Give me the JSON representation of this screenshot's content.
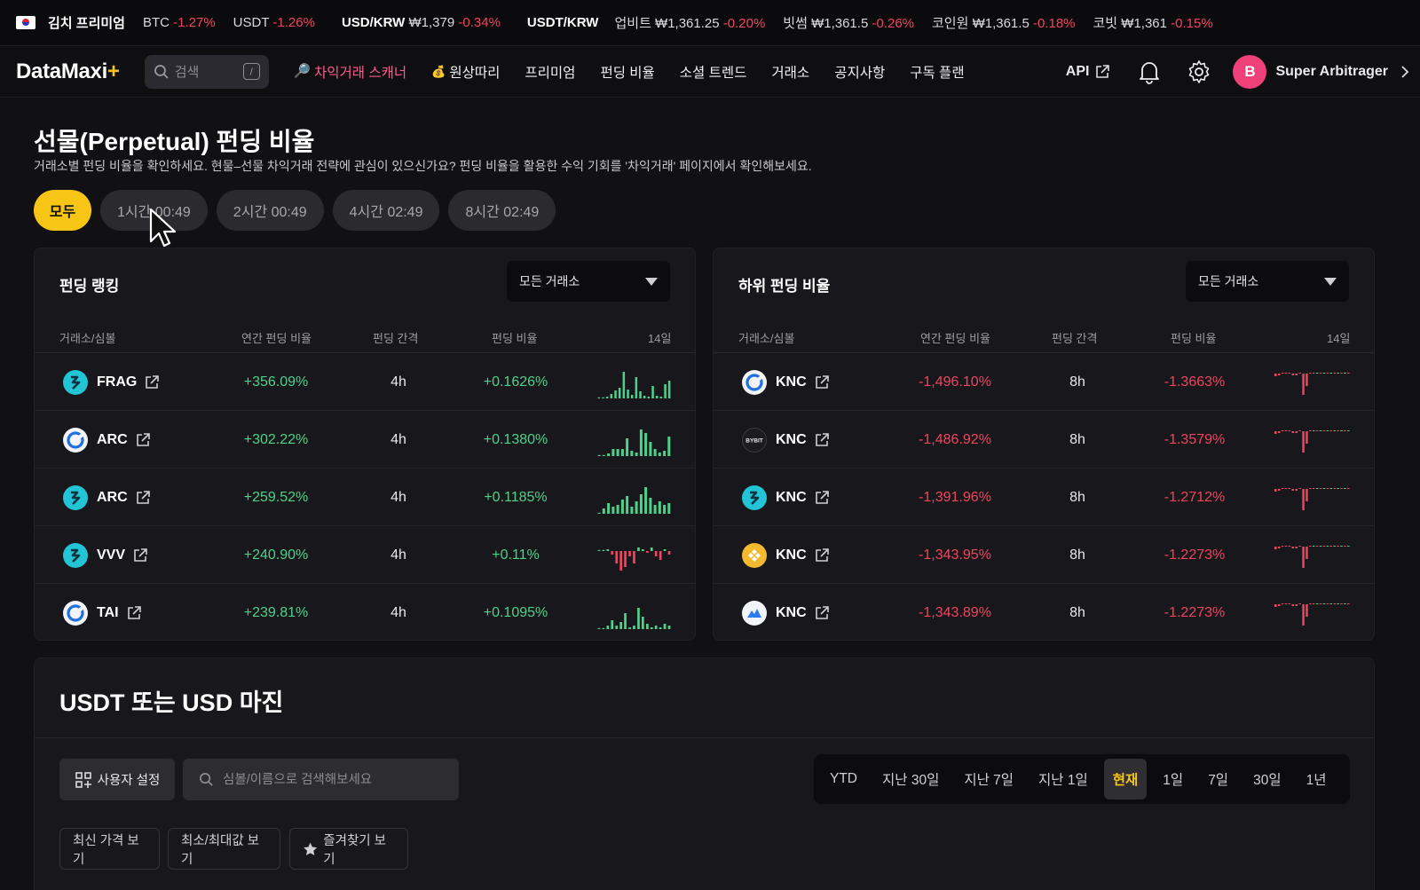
{
  "ticker": {
    "kimchi_label": "김치 프리미엄",
    "btc": {
      "label": "BTC",
      "change": "-1.27%"
    },
    "usdt": {
      "label": "USDT",
      "change": "-1.26%"
    },
    "usdkrw": {
      "label": "USD/KRW",
      "price": "₩1,379",
      "change": "-0.34%"
    },
    "usdtkrw_label": "USDT/KRW",
    "exchanges": [
      {
        "name": "업비트",
        "price": "₩1,361.25",
        "change": "-0.20%"
      },
      {
        "name": "빗썸",
        "price": "₩1,361.5",
        "change": "-0.26%"
      },
      {
        "name": "코인원",
        "price": "₩1,361.5",
        "change": "-0.18%"
      },
      {
        "name": "코빗",
        "price": "₩1,361",
        "change": "-0.15%"
      }
    ]
  },
  "nav": {
    "logo": "DataMaxi",
    "logo_plus": "+",
    "search_placeholder": "검색",
    "search_shortcut": "/",
    "menu": [
      {
        "label": "차익거래 스캐너",
        "icon": "magnifier-icon"
      },
      {
        "label": "원상따리",
        "icon": "moneybag-icon"
      },
      {
        "label": "프리미엄"
      },
      {
        "label": "펀딩 비율"
      },
      {
        "label": "소셜 트렌드"
      },
      {
        "label": "거래소"
      },
      {
        "label": "공지사항"
      },
      {
        "label": "구독 플랜"
      }
    ],
    "api_label": "API",
    "avatar_initial": "B",
    "username": "Super Arbitrager"
  },
  "header": {
    "title": "선물(Perpetual) 펀딩 비율",
    "subtitle": "거래소별 펀딩 비율을 확인하세요. 현물–선물 차익거래 전략에 관심이 있으신가요? 펀딩 비율을 활용한 수익 기회를 '차익거래' 페이지에서 확인해보세요.",
    "filters": [
      "모두",
      "1시간 00:49",
      "2시간 00:49",
      "4시간 02:49",
      "8시간 02:49"
    ]
  },
  "columns": {
    "symbol": "거래소/심볼",
    "annual": "연간 펀딩 비율",
    "interval": "펀딩 간격",
    "rate": "펀딩 비율",
    "days": "14일"
  },
  "top_panel": {
    "title": "펀딩 랭킹",
    "dropdown": "모든 거래소",
    "rows": [
      {
        "symbol": "FRAG",
        "annual": "+356.09%",
        "interval": "4h",
        "rate": "+0.1626%",
        "logo": "bitget",
        "spark": [
          0,
          0,
          2,
          5,
          9,
          12,
          30,
          10,
          4,
          24,
          8,
          3,
          2,
          14,
          3,
          2,
          16,
          20
        ]
      },
      {
        "symbol": "ARC",
        "annual": "+302.22%",
        "interval": "4h",
        "rate": "+0.1380%",
        "logo": "okx",
        "spark": [
          0,
          0,
          3,
          8,
          8,
          8,
          20,
          6,
          4,
          30,
          26,
          16,
          8,
          4,
          6,
          22
        ]
      },
      {
        "symbol": "ARC",
        "annual": "+259.52%",
        "interval": "4h",
        "rate": "+0.1185%",
        "logo": "bitget",
        "spark": [
          0,
          6,
          12,
          8,
          10,
          16,
          20,
          8,
          14,
          22,
          30,
          18,
          10,
          14,
          10,
          12
        ]
      },
      {
        "symbol": "VVV",
        "annual": "+240.90%",
        "interval": "4h",
        "rate": "+0.11%",
        "logo": "bitget",
        "spark": [
          0,
          0,
          2,
          -4,
          -14,
          -22,
          -18,
          -6,
          -14,
          4,
          2,
          -2,
          4,
          -6,
          -10,
          2,
          -4
        ]
      },
      {
        "symbol": "TAI",
        "annual": "+239.81%",
        "interval": "4h",
        "rate": "+0.1095%",
        "logo": "okx",
        "spark": [
          0,
          0,
          4,
          10,
          4,
          8,
          18,
          2,
          4,
          24,
          14,
          6,
          2,
          4,
          2,
          6,
          4
        ]
      }
    ]
  },
  "bottom_panel": {
    "title": "하위 펀딩 비율",
    "dropdown": "모든 거래소",
    "rows": [
      {
        "symbol": "KNC",
        "annual": "-1,496.10%",
        "interval": "8h",
        "rate": "-1.3663%",
        "logo": "okx"
      },
      {
        "symbol": "KNC",
        "annual": "-1,486.92%",
        "interval": "8h",
        "rate": "-1.3579%",
        "logo": "bybit",
        "logo_text": "BYBIT"
      },
      {
        "symbol": "KNC",
        "annual": "-1,391.96%",
        "interval": "8h",
        "rate": "-1.2712%",
        "logo": "bitget"
      },
      {
        "symbol": "KNC",
        "annual": "-1,343.95%",
        "interval": "8h",
        "rate": "-1.2273%",
        "logo": "binance"
      },
      {
        "symbol": "KNC",
        "annual": "-1,343.89%",
        "interval": "8h",
        "rate": "-1.2273%",
        "logo": "other"
      }
    ]
  },
  "margin": {
    "title": "USDT 또는 USD 마진",
    "user_settings": "사용자 설정",
    "search_placeholder": "심볼/이름으로 검색해보세요",
    "ranges": [
      "YTD",
      "지난 30일",
      "지난 7일",
      "지난 1일",
      "현재",
      "1일",
      "7일",
      "30일",
      "1년"
    ],
    "selected_range": "현재",
    "views": [
      "최신 가격 보기",
      "최소/최대값 보기",
      "즐겨찾기 보기"
    ]
  },
  "colors": {
    "accent": "#f6c515",
    "positive": "#4fd18b",
    "negative": "#f0445f",
    "nav_active": "#ff5b8c"
  }
}
